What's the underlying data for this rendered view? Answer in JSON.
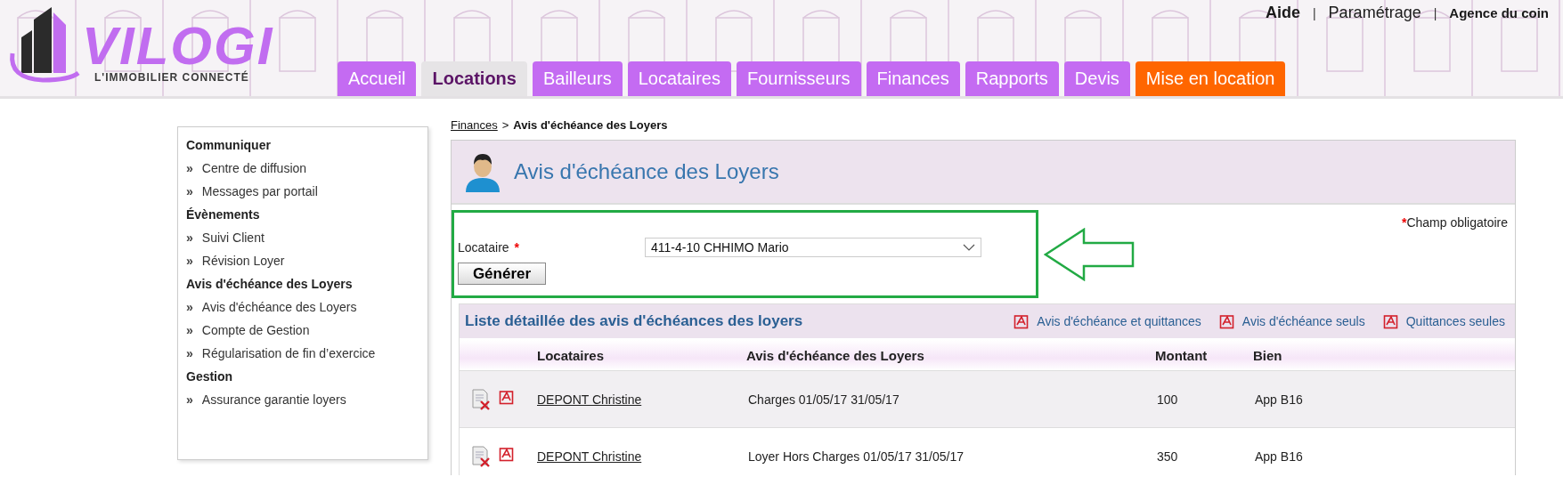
{
  "header": {
    "logo": {
      "name": "VILOGI",
      "tagline": "L'IMMOBILIER CONNECTÉ"
    },
    "top_links": [
      {
        "kind": "link",
        "label": "Aide",
        "bold": true
      },
      {
        "kind": "separator",
        "label": "|"
      },
      {
        "kind": "link",
        "label": "Paramétrage",
        "bold": false
      },
      {
        "kind": "separator",
        "label": "|"
      },
      {
        "kind": "agency",
        "label": "Agence du coin",
        "bold": true
      }
    ],
    "tabs": [
      {
        "label": "Accueil",
        "selected": false,
        "kind": "normal"
      },
      {
        "label": "Locations",
        "selected": true,
        "kind": "normal"
      },
      {
        "label": "Bailleurs",
        "selected": false,
        "kind": "normal"
      },
      {
        "label": "Locataires",
        "selected": false,
        "kind": "normal"
      },
      {
        "label": "Fournisseurs",
        "selected": false,
        "kind": "normal"
      },
      {
        "label": "Finances",
        "selected": false,
        "kind": "normal"
      },
      {
        "label": "Rapports",
        "selected": false,
        "kind": "normal"
      },
      {
        "label": "Devis",
        "selected": false,
        "kind": "normal"
      },
      {
        "label": "Mise en location",
        "selected": false,
        "kind": "highlight"
      }
    ]
  },
  "sidebar": {
    "sections": [
      {
        "title": "Communiquer",
        "items": [
          {
            "marker": "»",
            "label": "Centre de diffusion"
          },
          {
            "marker": "»",
            "label": "Messages par portail"
          }
        ]
      },
      {
        "title": "Évènements",
        "items": [
          {
            "marker": "»",
            "label": "Suivi Client"
          },
          {
            "marker": "»",
            "label": "Révision Loyer"
          }
        ]
      },
      {
        "title": "Avis d'échéance des Loyers",
        "items": [
          {
            "marker": "»",
            "label": "Avis d'échéance des Loyers"
          },
          {
            "marker": "»",
            "label": "Compte de Gestion"
          },
          {
            "marker": "»",
            "label": "Régularisation de fin d’exercice"
          }
        ]
      },
      {
        "title": "Gestion",
        "items": [
          {
            "marker": "»",
            "label": "Assurance garantie loyers"
          }
        ]
      }
    ]
  },
  "breadcrumb": {
    "link": "Finances",
    "separator": ">",
    "current": "Avis d'échéance des Loyers"
  },
  "panel": {
    "title": "Avis d'échéance des Loyers",
    "required_note": {
      "mark": "*",
      "text": "Champ obligatoire"
    },
    "form": {
      "label": "Locataire",
      "required_mark": "*",
      "value": "411-4-10 CHHIMO Mario",
      "button": "Générer"
    }
  },
  "list": {
    "title": "Liste détaillée des avis d'échéances des loyers",
    "actions": [
      "Avis d'échéance et quittances",
      "Avis d'échéance seuls",
      "Quittances seules"
    ],
    "columns": [
      "Locataires",
      "Avis d'échéance des Loyers",
      "Montant",
      "Bien"
    ],
    "rows": [
      {
        "locataire": "DEPONT Christine",
        "avis": "Charges 01/05/17 31/05/17",
        "montant": "100",
        "bien": "App B16"
      },
      {
        "locataire": "DEPONT Christine",
        "avis": "Loyer Hors Charges 01/05/17 31/05/17",
        "montant": "350",
        "bien": "App B16"
      }
    ]
  }
}
